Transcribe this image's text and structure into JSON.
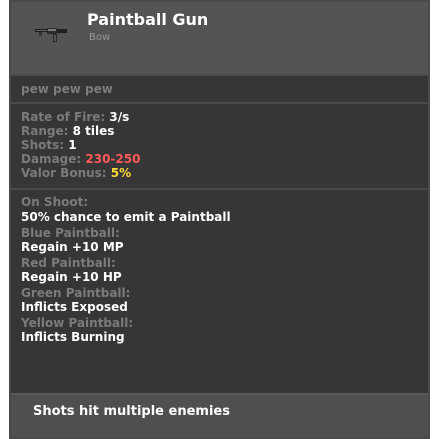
{
  "item": {
    "name": "Paintball Gun",
    "tier": "Bow",
    "icon": "paintball-gun-icon"
  },
  "description": "pew pew pew",
  "stats": {
    "rate_of_fire_label": "Rate of Fire:",
    "rate_of_fire_value": "3/s",
    "range_label": "Range:",
    "range_value": "8 tiles",
    "shots_label": "Shots:",
    "shots_value": "1",
    "damage_label": "Damage:",
    "damage_value": "230-250",
    "valor_label": "Valor Bonus:",
    "valor_value": "5%"
  },
  "on_shoot": {
    "header": "On Shoot:",
    "chance_text": "50% chance to emit a Paintball",
    "effects": [
      {
        "name": "Blue Paintball:",
        "effect": "Regain +10 MP"
      },
      {
        "name": "Red Paintball:",
        "effect": "Regain +10 HP"
      },
      {
        "name": "Green Paintball:",
        "effect": "Inflicts Exposed"
      },
      {
        "name": "Yellow Paintball:",
        "effect": "Inflicts Burning"
      }
    ]
  },
  "footer": {
    "text": "Shots hit multiple enemies"
  },
  "colors": {
    "background": "#363636",
    "header": "#545454",
    "muted_text": "#7b7b7b",
    "damage": "#ff5a5a",
    "valor": "#ffd83a"
  }
}
